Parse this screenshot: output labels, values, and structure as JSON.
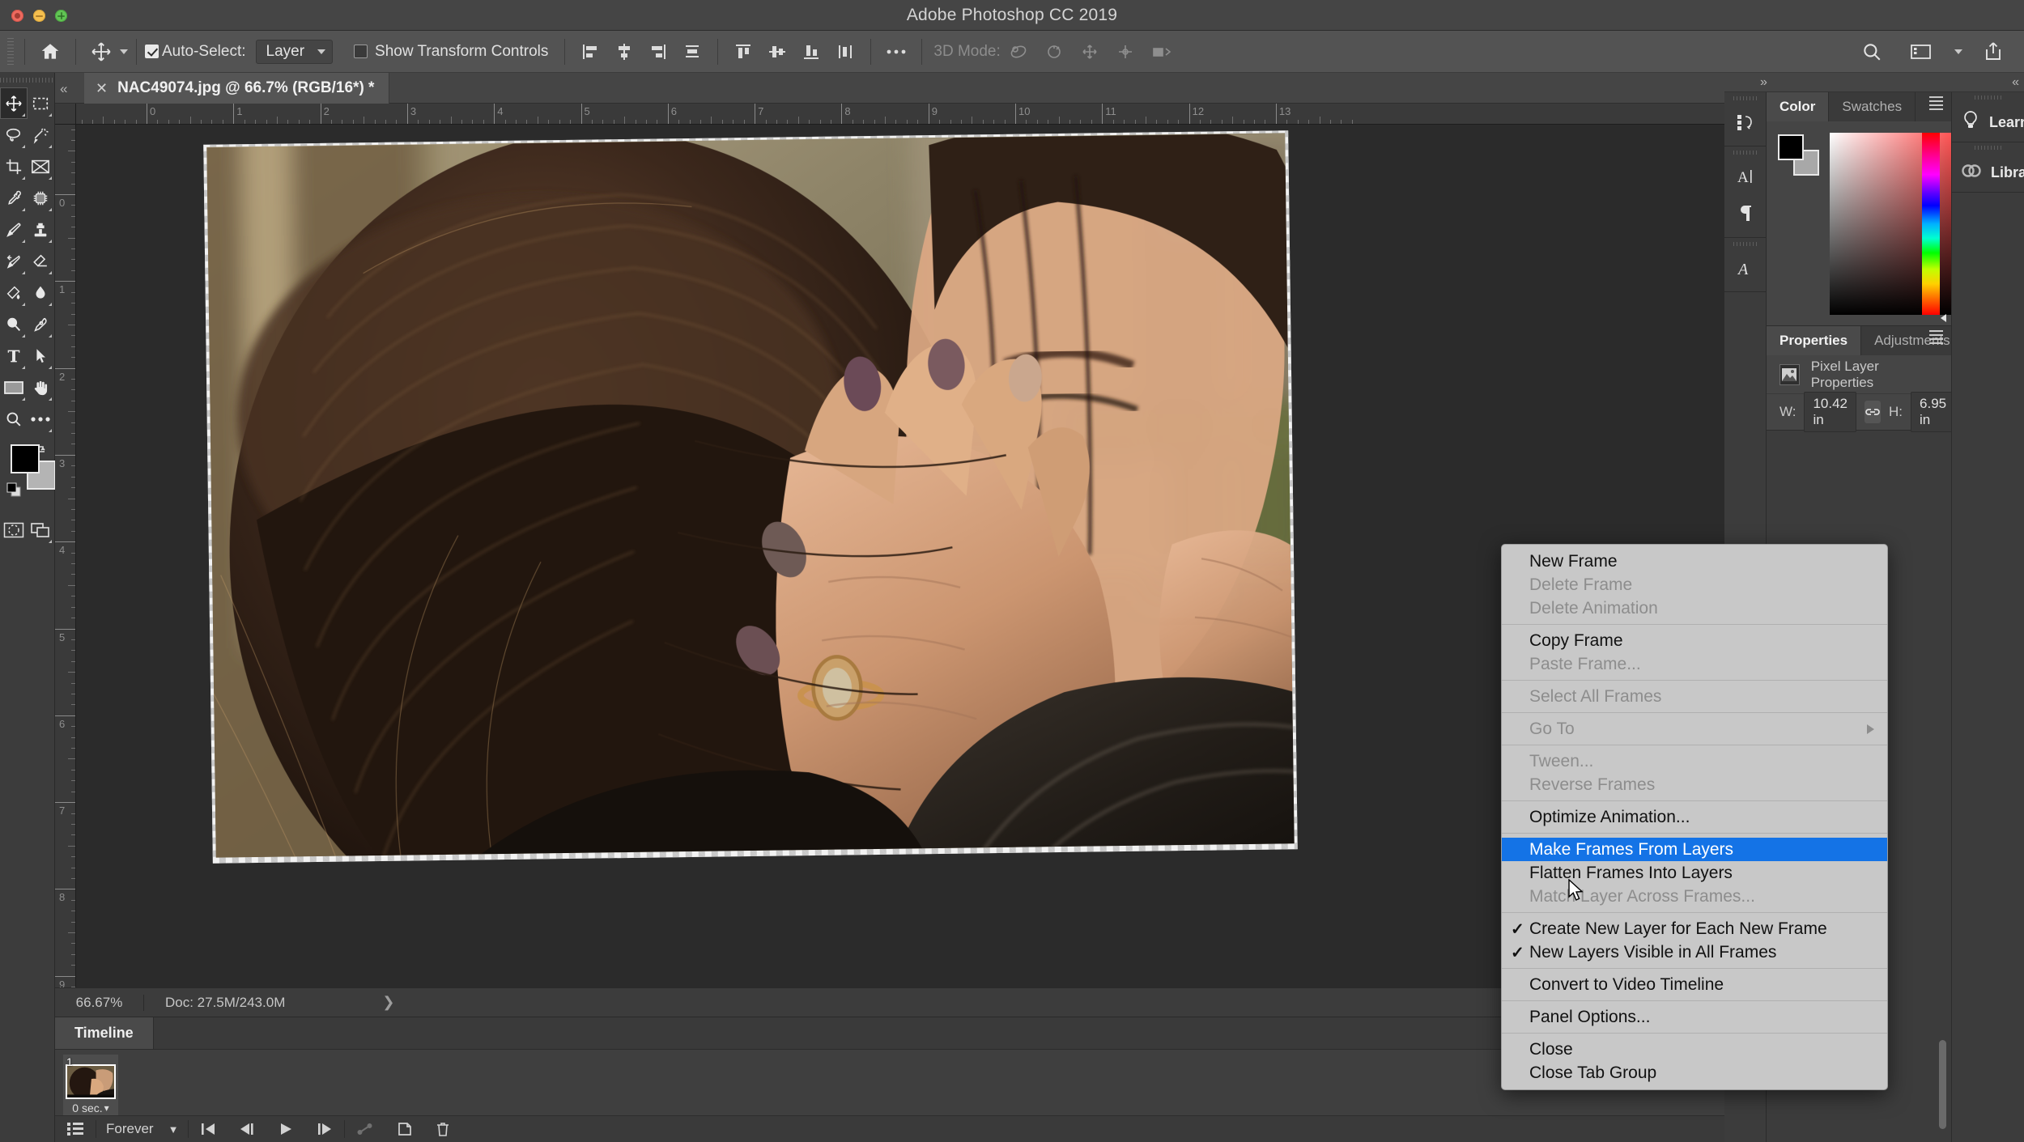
{
  "window": {
    "app_title": "Adobe Photoshop CC 2019",
    "traffic_lights": [
      "close",
      "minimize",
      "zoom"
    ]
  },
  "options_bar": {
    "home_icon": "home-icon",
    "tool_icon": "move-tool-icon",
    "auto_select_label": "Auto-Select:",
    "auto_select_checked": true,
    "auto_select_value": "Layer",
    "show_transform_label": "Show Transform Controls",
    "show_transform_checked": false,
    "align_icons": [
      "align-left-edges-icon",
      "align-horizontal-centers-icon",
      "align-right-edges-icon",
      "distribute-horizontally-icon"
    ],
    "align_icons2": [
      "align-top-edges-icon",
      "align-vertical-centers-icon",
      "align-bottom-edges-icon",
      "distribute-vertically-icon"
    ],
    "more_icon": "more-options-icon",
    "three_d_mode_label": "3D Mode:",
    "three_d_icons": [
      "rotate-3d-icon",
      "roll-3d-icon",
      "pan-3d-icon",
      "slide-3d-icon",
      "scale-3d-icon"
    ],
    "right_icons": [
      "search-icon",
      "workspace-icon",
      "chevron-down-icon",
      "share-icon"
    ]
  },
  "toolbar": {
    "tools": [
      {
        "name": "move-tool",
        "active": true
      },
      {
        "name": "rectangular-marquee-tool",
        "active": false
      },
      {
        "name": "lasso-tool",
        "active": false
      },
      {
        "name": "object-selection-tool",
        "active": false
      },
      {
        "name": "crop-tool",
        "active": false
      },
      {
        "name": "frame-tool",
        "active": false
      },
      {
        "name": "eyedropper-tool",
        "active": false
      },
      {
        "name": "spot-healing-brush-tool",
        "active": false
      },
      {
        "name": "brush-tool",
        "active": false
      },
      {
        "name": "clone-stamp-tool",
        "active": false
      },
      {
        "name": "history-brush-tool",
        "active": false
      },
      {
        "name": "eraser-tool",
        "active": false
      },
      {
        "name": "gradient-tool",
        "active": false
      },
      {
        "name": "blur-tool",
        "active": false
      },
      {
        "name": "dodge-tool",
        "active": false
      },
      {
        "name": "pen-tool",
        "active": false
      },
      {
        "name": "type-tool",
        "active": false
      },
      {
        "name": "path-selection-tool",
        "active": false
      },
      {
        "name": "rectangle-tool",
        "active": false
      },
      {
        "name": "hand-tool",
        "active": false
      },
      {
        "name": "zoom-tool",
        "active": false
      },
      {
        "name": "edit-toolbar-tool",
        "active": false
      }
    ],
    "foreground_color": "#000000",
    "background_color": "#b4b4b4",
    "swap_colors_icon": "swap-colors-icon",
    "default_colors_icon": "default-colors-icon",
    "quick_mask_icon": "quick-mask-icon",
    "screen_mode_icon": "screen-mode-icon"
  },
  "document": {
    "tab_title": "NAC49074.jpg @ 66.7% (RGB/16*) *",
    "close_icon": "close-icon",
    "ruler_units": "inches",
    "ruler_h_labels": [
      "1",
      "0",
      "1",
      "2",
      "3",
      "4",
      "5",
      "6",
      "7",
      "8",
      "9",
      "10",
      "11",
      "12"
    ],
    "ruler_v_labels": [
      "0",
      "1",
      "2",
      "3",
      "4",
      "5",
      "6",
      "7",
      "8"
    ]
  },
  "status_bar": {
    "zoom": "66.67%",
    "doc_info": "Doc: 27.5M/243.0M",
    "expand_icon": "chevron-right-icon"
  },
  "timeline": {
    "tab_label": "Timeline",
    "frames": [
      {
        "number": "1",
        "duration": "0 sec."
      }
    ],
    "duration_chevron": "chevron-down-icon",
    "convert_icon": "convert-to-video-timeline-icon",
    "loop_value": "Forever",
    "loop_chevron": "chevron-down-icon",
    "controls": [
      {
        "name": "select-first-frame-button",
        "icon": "skip-to-start-icon",
        "enabled": true
      },
      {
        "name": "select-previous-frame-button",
        "icon": "step-back-icon",
        "enabled": true
      },
      {
        "name": "play-animation-button",
        "icon": "play-icon",
        "enabled": true
      },
      {
        "name": "select-next-frame-button",
        "icon": "step-forward-icon",
        "enabled": true
      },
      {
        "name": "tween-frames-button",
        "icon": "tween-icon",
        "enabled": false
      },
      {
        "name": "duplicate-frame-button",
        "icon": "duplicate-icon",
        "enabled": true
      },
      {
        "name": "delete-frame-button",
        "icon": "trash-icon",
        "enabled": true
      }
    ]
  },
  "right_dock": {
    "expand_icon": "chevron-double-right-icon",
    "collapse_icon": "chevron-double-left-icon",
    "icon_rail": [
      {
        "name": "history-panel-icon"
      },
      {
        "name": "character-panel-icon"
      },
      {
        "name": "paragraph-panel-icon"
      },
      {
        "name": "glyphs-panel-icon"
      }
    ],
    "color_panel": {
      "tabs": [
        {
          "label": "Color",
          "active": true
        },
        {
          "label": "Swatches",
          "active": false
        }
      ],
      "menu_icon": "panel-menu-icon",
      "foreground_color": "#000000",
      "background_color": "#a8a8a8",
      "picker_base_hue": "#ff0000"
    },
    "properties_panel": {
      "tabs": [
        {
          "label": "Properties",
          "active": true
        },
        {
          "label": "Adjustments",
          "active": false
        }
      ],
      "menu_icon": "panel-menu-icon",
      "layer_type_icon": "pixel-layer-icon",
      "layer_type_label": "Pixel Layer Properties",
      "width_label": "W:",
      "width_value": "10.42 in",
      "link_icon": "link-dimensions-icon",
      "height_label": "H:",
      "height_value": "6.95 in"
    },
    "mini_panels": [
      {
        "label": "Learn",
        "icon": "lightbulb-icon"
      },
      {
        "label": "Libraries",
        "icon": "creative-cloud-libraries-icon"
      }
    ]
  },
  "context_menu": {
    "items": [
      {
        "label": "New Frame",
        "state": "enabled"
      },
      {
        "label": "Delete Frame",
        "state": "disabled"
      },
      {
        "label": "Delete Animation",
        "state": "disabled"
      },
      {
        "separator": true
      },
      {
        "label": "Copy Frame",
        "state": "enabled"
      },
      {
        "label": "Paste Frame...",
        "state": "disabled"
      },
      {
        "separator": true
      },
      {
        "label": "Select All Frames",
        "state": "disabled"
      },
      {
        "separator": true
      },
      {
        "label": "Go To",
        "state": "disabled",
        "submenu": true
      },
      {
        "separator": true
      },
      {
        "label": "Tween...",
        "state": "disabled"
      },
      {
        "label": "Reverse Frames",
        "state": "disabled"
      },
      {
        "separator": true
      },
      {
        "label": "Optimize Animation...",
        "state": "enabled"
      },
      {
        "separator": true
      },
      {
        "label": "Make Frames From Layers",
        "state": "selected"
      },
      {
        "label": "Flatten Frames Into Layers",
        "state": "enabled"
      },
      {
        "label": "Match Layer Across Frames...",
        "state": "disabled"
      },
      {
        "separator": true
      },
      {
        "label": "Create New Layer for Each New Frame",
        "state": "enabled",
        "checked": true
      },
      {
        "label": "New Layers Visible in All Frames",
        "state": "enabled",
        "checked": true
      },
      {
        "separator": true
      },
      {
        "label": "Convert to Video Timeline",
        "state": "enabled"
      },
      {
        "separator": true
      },
      {
        "label": "Panel Options...",
        "state": "enabled"
      },
      {
        "separator": true
      },
      {
        "label": "Close",
        "state": "enabled"
      },
      {
        "label": "Close Tab Group",
        "state": "enabled"
      }
    ],
    "highlight_color": "#1473e6"
  }
}
